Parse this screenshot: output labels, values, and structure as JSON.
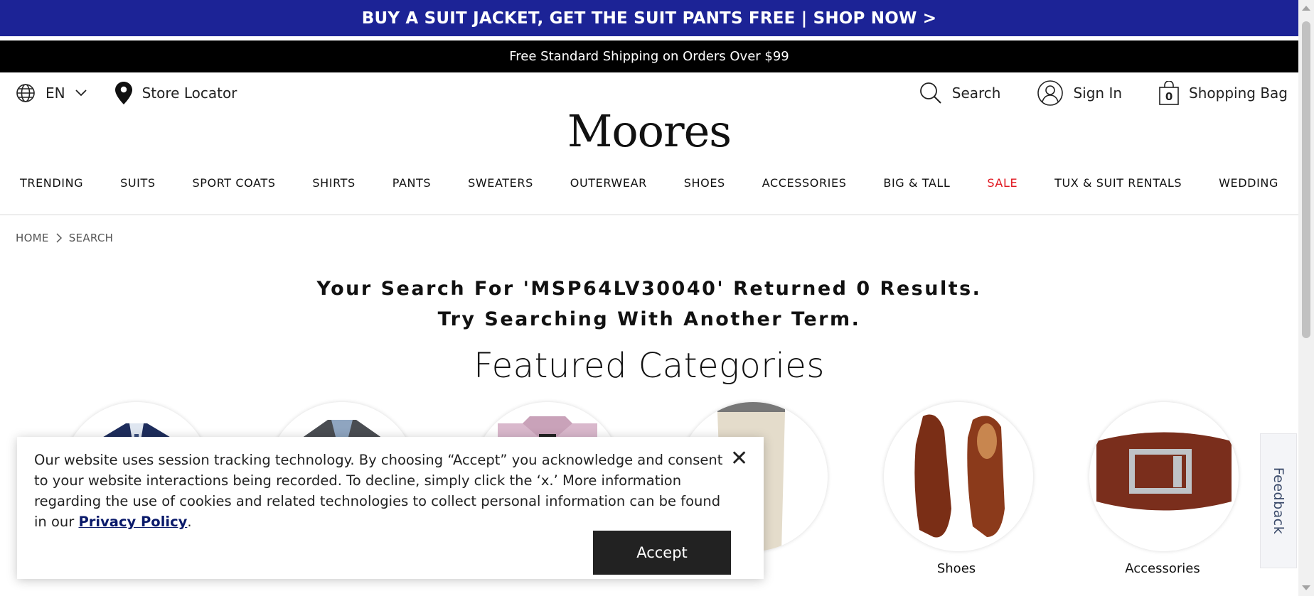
{
  "promo": {
    "text": "BUY A SUIT JACKET, GET THE SUIT PANTS FREE | SHOP NOW >"
  },
  "shipping": {
    "text": "Free Standard Shipping on Orders Over $99"
  },
  "utility": {
    "language": "EN",
    "store_locator": "Store Locator",
    "search": "Search",
    "sign_in": "Sign In",
    "bag_count": "0",
    "shopping_bag": "Shopping Bag"
  },
  "logo": "Moores",
  "nav": [
    "TRENDING",
    "SUITS",
    "SPORT COATS",
    "SHIRTS",
    "PANTS",
    "SWEATERS",
    "OUTERWEAR",
    "SHOES",
    "ACCESSORIES",
    "BIG & TALL",
    "SALE",
    "TUX & SUIT RENTALS",
    "WEDDING"
  ],
  "sale_color": "#e0161f",
  "breadcrumb": {
    "home": "HOME",
    "current": "SEARCH"
  },
  "results": {
    "line1": "Your Search For 'MSP64LV30040' Returned 0 Results.",
    "line2": "Try Searching With Another Term."
  },
  "featured": {
    "title": "Featured Categories",
    "categories": [
      {
        "label": "",
        "icon": "suit-jacket-image"
      },
      {
        "label": "",
        "icon": "sport-coat-image"
      },
      {
        "label": "",
        "icon": "dress-shirt-image"
      },
      {
        "label": "s",
        "icon": "pants-image"
      },
      {
        "label": "Shoes",
        "icon": "shoes-image"
      },
      {
        "label": "Accessories",
        "icon": "belt-image"
      }
    ]
  },
  "feedback": "Feedback",
  "cookie": {
    "text_before": "Our website uses session tracking technology. By choosing “Accept” you acknowledge and consent to your website interactions being recorded. To decline, simply click the ‘x.’ More information regarding the use of cookies and related technologies to collect personal information can be found in our ",
    "link": "Privacy Policy",
    "text_after": ".",
    "accept": "Accept",
    "close": "✕"
  },
  "colors": {
    "promo_bg": "#1c2396",
    "ship_bg": "#000000",
    "accept_bg": "#222222"
  }
}
